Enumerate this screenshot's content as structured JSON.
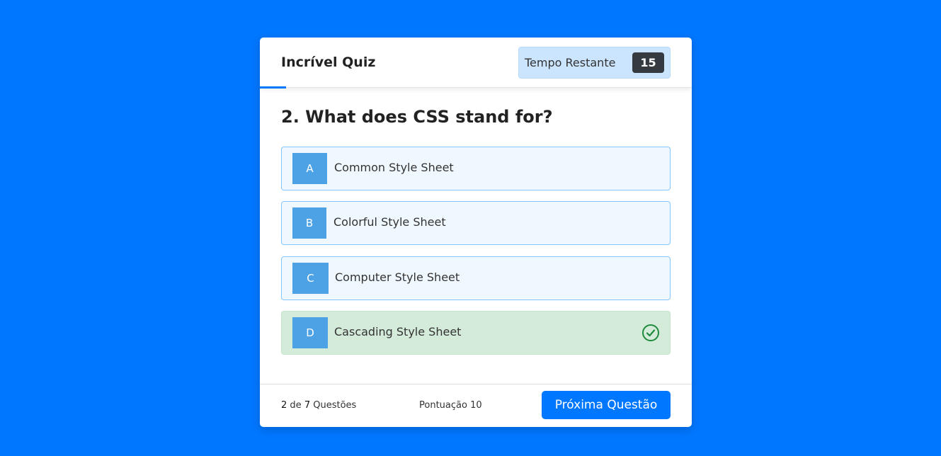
{
  "quiz": {
    "title": "Incrível Quiz",
    "timer_label": "Tempo Restante",
    "timer_seconds": "15"
  },
  "question": {
    "text": "2. What does CSS stand for?",
    "options": [
      {
        "letter": "A",
        "text": "Common Style Sheet",
        "state": "default"
      },
      {
        "letter": "B",
        "text": "Colorful Style Sheet",
        "state": "default"
      },
      {
        "letter": "C",
        "text": "Computer Style Sheet",
        "state": "default"
      },
      {
        "letter": "D",
        "text": "Cascading Style Sheet",
        "state": "correct",
        "icon": "check-circle-icon"
      }
    ]
  },
  "footer": {
    "current": "2",
    "of_text": "de",
    "total": "7",
    "questions_text": "Questões",
    "score_text": "Pontuação 10",
    "next_label": "Próxima Questão"
  },
  "colors": {
    "background": "#0077ff",
    "option_default": "#f0f8ff",
    "option_correct": "#d4ebd9",
    "letter_box": "#4da2e6",
    "check_icon": "#1e8a3e"
  }
}
